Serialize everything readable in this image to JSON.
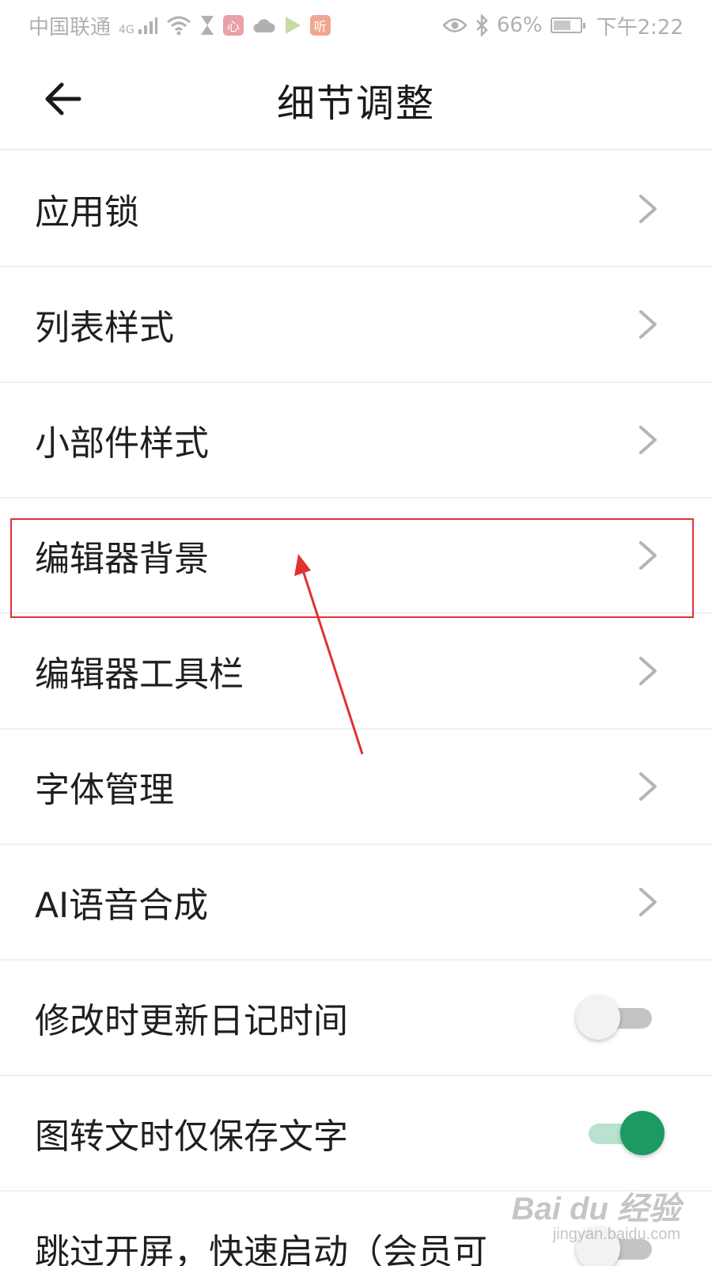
{
  "status_bar": {
    "carrier": "中国联通",
    "network": "4G",
    "app_icon_1": "心",
    "app_icon_2": "听",
    "battery": "66%",
    "time": "下午2:22",
    "battery_level": 0.66,
    "icons": [
      "signal-icon",
      "wifi-icon",
      "hourglass-icon",
      "cloud-icon",
      "play-icon",
      "eye-icon",
      "bluetooth-icon",
      "battery-icon"
    ]
  },
  "header": {
    "title": "细节调整",
    "back_icon": "arrow-left-icon"
  },
  "settings": {
    "items": [
      {
        "label": "应用锁",
        "type": "nav"
      },
      {
        "label": "列表样式",
        "type": "nav"
      },
      {
        "label": "小部件样式",
        "type": "nav"
      },
      {
        "label": "编辑器背景",
        "type": "nav",
        "highlighted": true
      },
      {
        "label": "编辑器工具栏",
        "type": "nav"
      },
      {
        "label": "字体管理",
        "type": "nav"
      },
      {
        "label": "AI语音合成",
        "type": "nav"
      },
      {
        "label": "修改时更新日记时间",
        "type": "toggle",
        "on": false
      },
      {
        "label": "图转文时仅保存文字",
        "type": "toggle",
        "on": true
      },
      {
        "label": "跳过开屏，快速启动（会员可",
        "type": "toggle",
        "on": false
      }
    ]
  },
  "colors": {
    "accent": "#1c9a62",
    "annotation": "#e0322e"
  },
  "watermark": {
    "logo": "Bai du 经验",
    "url": "jingyan.baidu.com"
  }
}
